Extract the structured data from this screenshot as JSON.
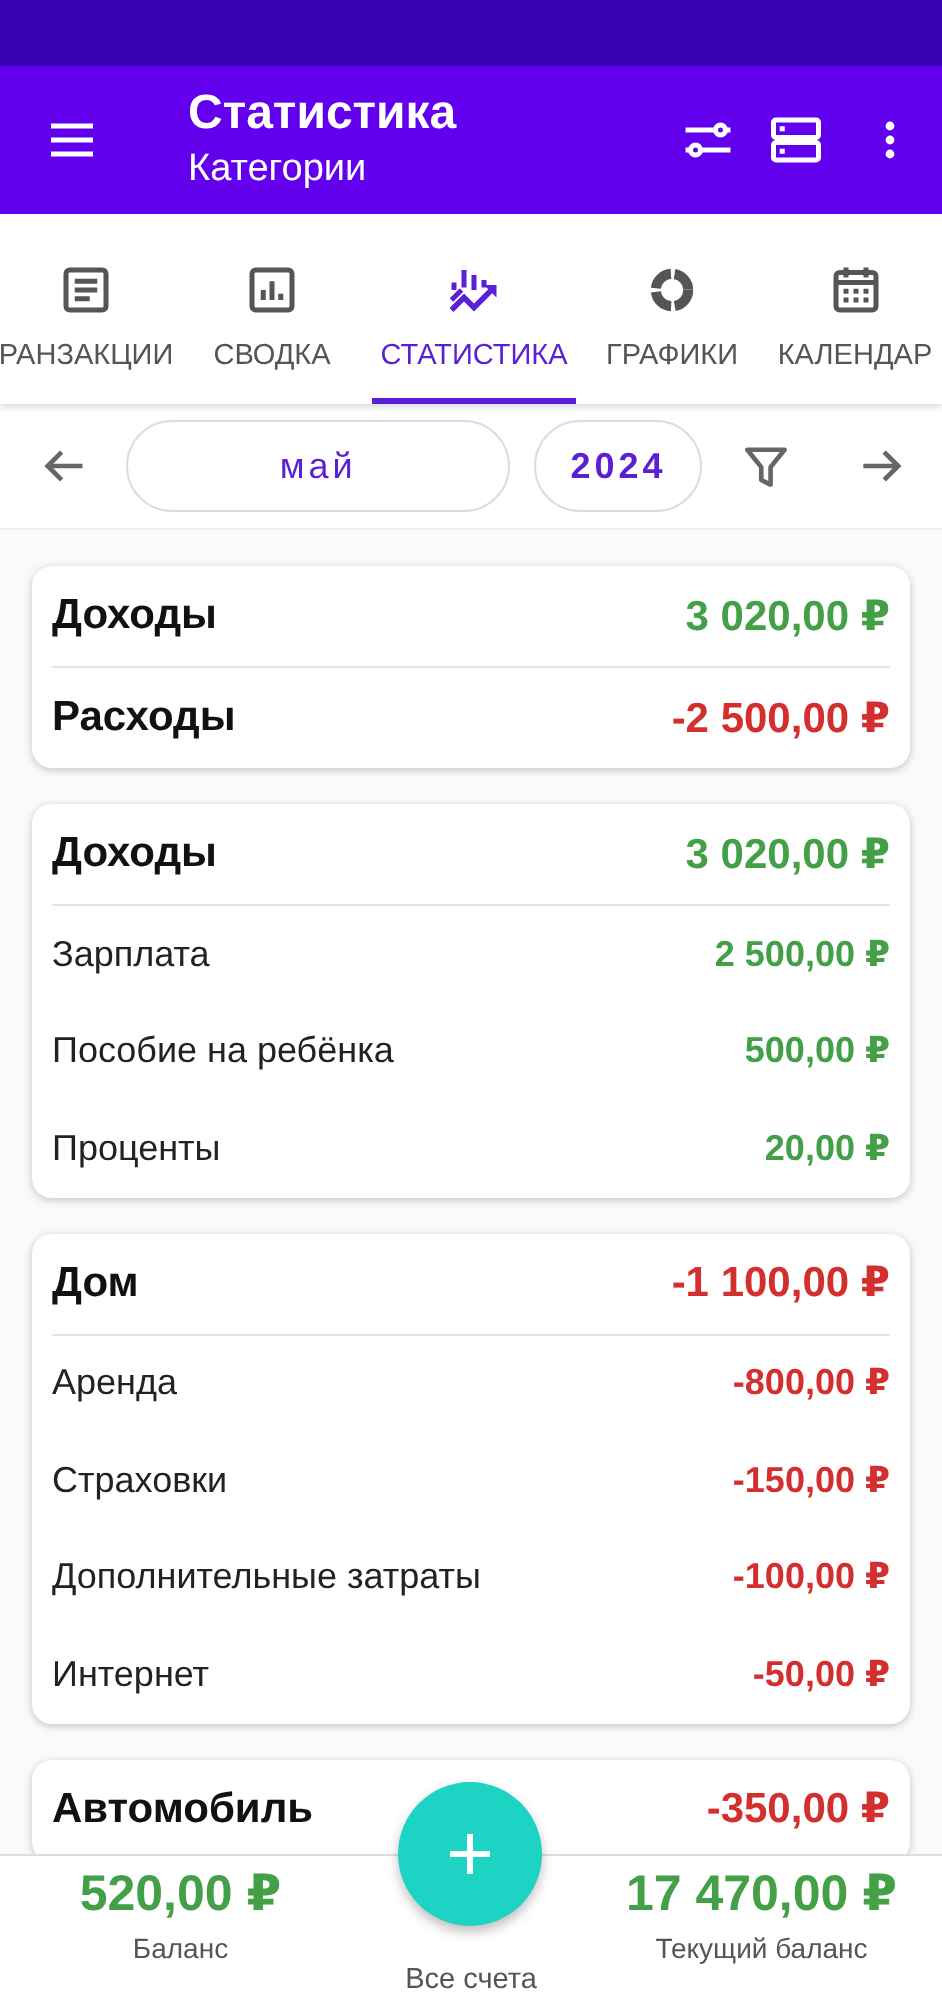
{
  "app_bar": {
    "title": "Статистика",
    "subtitle": "Категории"
  },
  "tabs": [
    {
      "label": "РАНЗАКЦИИ",
      "kind": "document",
      "selected": false
    },
    {
      "label": "СВОДКА",
      "kind": "barchart",
      "selected": false
    },
    {
      "label": "СТАТИСТИКА",
      "kind": "trend",
      "selected": true
    },
    {
      "label": "ГРАФИКИ",
      "kind": "donut",
      "selected": false
    },
    {
      "label": "КАЛЕНДАР",
      "kind": "calendar",
      "selected": false
    }
  ],
  "period": {
    "month": "май",
    "year": "2024"
  },
  "summary": [
    {
      "label": "Доходы",
      "amount": "3 020,00 ₽",
      "kind": "income"
    },
    {
      "label": "Расходы",
      "amount": "-2 500,00 ₽",
      "kind": "expense"
    }
  ],
  "groups": [
    {
      "name": "Доходы",
      "total": "3 020,00 ₽",
      "kind": "income",
      "items": [
        {
          "name": "Зарплата",
          "amount": "2 500,00 ₽"
        },
        {
          "name": "Пособие на ребёнка",
          "amount": "500,00 ₽"
        },
        {
          "name": "Проценты",
          "amount": "20,00 ₽"
        }
      ]
    },
    {
      "name": "Дом",
      "total": "-1 100,00 ₽",
      "kind": "expense",
      "items": [
        {
          "name": "Аренда",
          "amount": "-800,00 ₽"
        },
        {
          "name": "Страховки",
          "amount": "-150,00 ₽"
        },
        {
          "name": "Дополнительные затраты",
          "amount": "-100,00 ₽"
        },
        {
          "name": "Интернет",
          "amount": "-50,00 ₽"
        }
      ]
    },
    {
      "name": "Автомобиль",
      "total": "-350,00 ₽",
      "kind": "expense"
    }
  ],
  "footer": {
    "balance": {
      "amount": "520,00 ₽",
      "label": "Баланс",
      "kind": "income"
    },
    "accounts": "Все счета",
    "current": {
      "amount": "17 470,00 ₽",
      "label": "Текущий баланс",
      "kind": "income"
    }
  }
}
